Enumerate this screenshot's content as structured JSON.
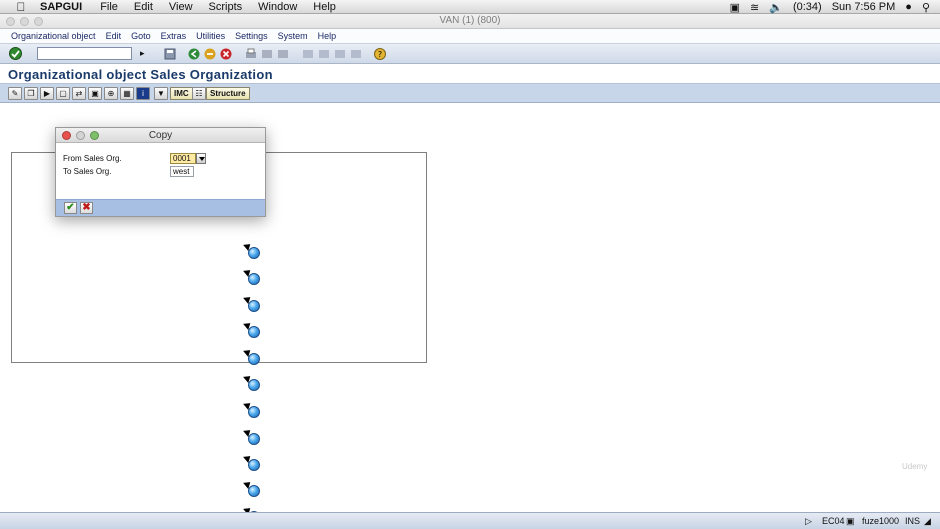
{
  "macmenu": {
    "app": "SAPGUI",
    "items": [
      "File",
      "Edit",
      "View",
      "Scripts",
      "Window",
      "Help"
    ],
    "battery": "(0:34)",
    "clock": "Sun 7:56 PM"
  },
  "window": {
    "title": "VAN (1) (800)"
  },
  "sapmenu": [
    "Organizational object",
    "Edit",
    "Goto",
    "Extras",
    "Utilities",
    "Settings",
    "System",
    "Help"
  ],
  "screen": {
    "title": "Organizational object Sales Organization"
  },
  "apptoolbar": {
    "imc_label": "IMC",
    "structure_label": "Structure"
  },
  "dialog": {
    "title": "Copy",
    "from_label": "From Sales Org.",
    "from_value": "0001",
    "to_label": "To Sales Org.",
    "to_value": "west"
  },
  "statusbar": {
    "system": "EC04",
    "server": "fuze1000",
    "mode": "INS"
  },
  "watermark": "Udemy",
  "colors": {
    "accent": "#1a3a6a",
    "dialog_footer": "#a7bfe3",
    "active_field": "#ffeaa4"
  }
}
